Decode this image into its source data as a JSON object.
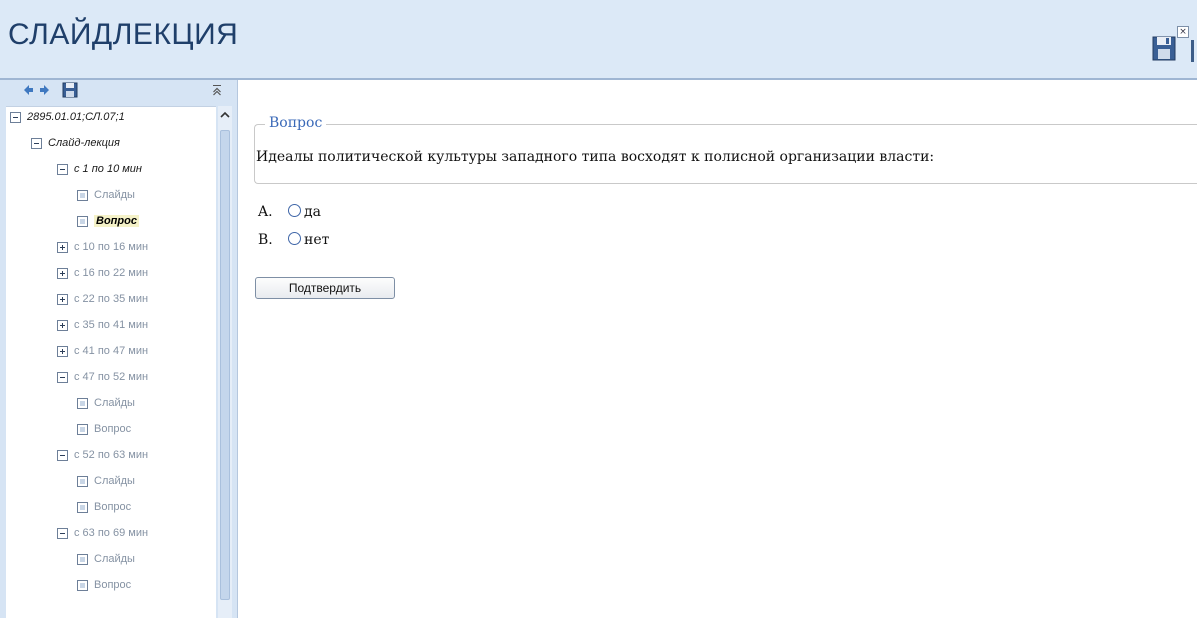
{
  "header": {
    "title": "СЛАЙДЛЕКЦИЯ"
  },
  "nav": {
    "tree": [
      {
        "label": "2895.01.01;СЛ.07;1",
        "expander": "minus",
        "level": 0,
        "style": "dark"
      },
      {
        "label": "Слайд-лекция",
        "expander": "minus",
        "level": 1,
        "style": "dark"
      },
      {
        "label": "с 1 по 10 мин",
        "expander": "minus",
        "level": 2,
        "style": "dark"
      },
      {
        "label": "Слайды",
        "expander": "leaf",
        "level": 3,
        "style": "gray"
      },
      {
        "label": "Вопрос",
        "expander": "leaf",
        "level": 3,
        "style": "selected"
      },
      {
        "label": "с 10 по 16 мин",
        "expander": "plus",
        "level": 2,
        "style": "gray"
      },
      {
        "label": "с 16 по 22 мин",
        "expander": "plus",
        "level": 2,
        "style": "gray"
      },
      {
        "label": "с 22 по 35 мин",
        "expander": "plus",
        "level": 2,
        "style": "gray"
      },
      {
        "label": "с 35 по 41 мин",
        "expander": "plus",
        "level": 2,
        "style": "gray"
      },
      {
        "label": "с 41 по 47 мин",
        "expander": "plus",
        "level": 2,
        "style": "gray"
      },
      {
        "label": "с 47 по 52 мин",
        "expander": "minus",
        "level": 2,
        "style": "gray"
      },
      {
        "label": "Слайды",
        "expander": "leaf",
        "level": 3,
        "style": "gray"
      },
      {
        "label": "Вопрос",
        "expander": "leaf",
        "level": 3,
        "style": "gray"
      },
      {
        "label": "с 52 по 63 мин",
        "expander": "minus",
        "level": 2,
        "style": "gray"
      },
      {
        "label": "Слайды",
        "expander": "leaf",
        "level": 3,
        "style": "gray"
      },
      {
        "label": "Вопрос",
        "expander": "leaf",
        "level": 3,
        "style": "gray"
      },
      {
        "label": "с 63 по 69 мин",
        "expander": "minus",
        "level": 2,
        "style": "gray"
      },
      {
        "label": "Слайды",
        "expander": "leaf",
        "level": 3,
        "style": "gray"
      },
      {
        "label": "Вопрос",
        "expander": "leaf",
        "level": 3,
        "style": "gray"
      }
    ]
  },
  "question": {
    "legend": "Вопрос",
    "text": "Идеалы политической культуры западного типа восходят к полисной организации власти:",
    "options": [
      {
        "letter": "A.",
        "label": "да"
      },
      {
        "letter": "B.",
        "label": "нет"
      }
    ],
    "submit_label": "Подтвердить"
  },
  "colors": {
    "header_bg": "#dce9f7",
    "title_color": "#1f3f6a",
    "legend_color": "#3a69b8",
    "selected_highlight": "#f5f2c8"
  }
}
